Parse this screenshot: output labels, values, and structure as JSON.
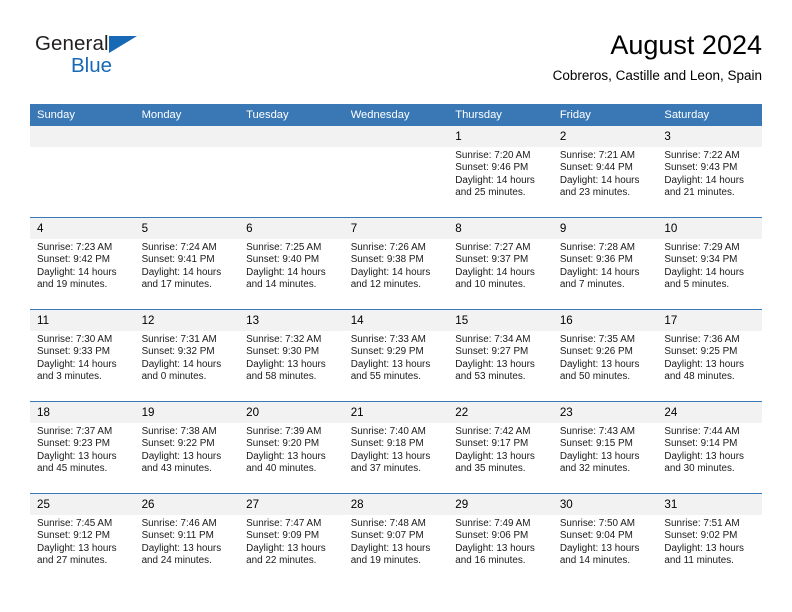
{
  "brand": {
    "name_dark": "General",
    "name_blue": "Blue",
    "accent_color": "#1769b5"
  },
  "header": {
    "title": "August 2024",
    "subtitle": "Cobreros, Castille and Leon, Spain"
  },
  "calendar": {
    "header_bg": "#3a78b5",
    "daynum_bg": "#f2f2f2",
    "weekday_headers": [
      "Sunday",
      "Monday",
      "Tuesday",
      "Wednesday",
      "Thursday",
      "Friday",
      "Saturday"
    ],
    "weeks": [
      [
        {
          "day": "",
          "lines": []
        },
        {
          "day": "",
          "lines": []
        },
        {
          "day": "",
          "lines": []
        },
        {
          "day": "",
          "lines": []
        },
        {
          "day": "1",
          "lines": [
            "Sunrise: 7:20 AM",
            "Sunset: 9:46 PM",
            "Daylight: 14 hours",
            "and 25 minutes."
          ]
        },
        {
          "day": "2",
          "lines": [
            "Sunrise: 7:21 AM",
            "Sunset: 9:44 PM",
            "Daylight: 14 hours",
            "and 23 minutes."
          ]
        },
        {
          "day": "3",
          "lines": [
            "Sunrise: 7:22 AM",
            "Sunset: 9:43 PM",
            "Daylight: 14 hours",
            "and 21 minutes."
          ]
        }
      ],
      [
        {
          "day": "4",
          "lines": [
            "Sunrise: 7:23 AM",
            "Sunset: 9:42 PM",
            "Daylight: 14 hours",
            "and 19 minutes."
          ]
        },
        {
          "day": "5",
          "lines": [
            "Sunrise: 7:24 AM",
            "Sunset: 9:41 PM",
            "Daylight: 14 hours",
            "and 17 minutes."
          ]
        },
        {
          "day": "6",
          "lines": [
            "Sunrise: 7:25 AM",
            "Sunset: 9:40 PM",
            "Daylight: 14 hours",
            "and 14 minutes."
          ]
        },
        {
          "day": "7",
          "lines": [
            "Sunrise: 7:26 AM",
            "Sunset: 9:38 PM",
            "Daylight: 14 hours",
            "and 12 minutes."
          ]
        },
        {
          "day": "8",
          "lines": [
            "Sunrise: 7:27 AM",
            "Sunset: 9:37 PM",
            "Daylight: 14 hours",
            "and 10 minutes."
          ]
        },
        {
          "day": "9",
          "lines": [
            "Sunrise: 7:28 AM",
            "Sunset: 9:36 PM",
            "Daylight: 14 hours",
            "and 7 minutes."
          ]
        },
        {
          "day": "10",
          "lines": [
            "Sunrise: 7:29 AM",
            "Sunset: 9:34 PM",
            "Daylight: 14 hours",
            "and 5 minutes."
          ]
        }
      ],
      [
        {
          "day": "11",
          "lines": [
            "Sunrise: 7:30 AM",
            "Sunset: 9:33 PM",
            "Daylight: 14 hours",
            "and 3 minutes."
          ]
        },
        {
          "day": "12",
          "lines": [
            "Sunrise: 7:31 AM",
            "Sunset: 9:32 PM",
            "Daylight: 14 hours",
            "and 0 minutes."
          ]
        },
        {
          "day": "13",
          "lines": [
            "Sunrise: 7:32 AM",
            "Sunset: 9:30 PM",
            "Daylight: 13 hours",
            "and 58 minutes."
          ]
        },
        {
          "day": "14",
          "lines": [
            "Sunrise: 7:33 AM",
            "Sunset: 9:29 PM",
            "Daylight: 13 hours",
            "and 55 minutes."
          ]
        },
        {
          "day": "15",
          "lines": [
            "Sunrise: 7:34 AM",
            "Sunset: 9:27 PM",
            "Daylight: 13 hours",
            "and 53 minutes."
          ]
        },
        {
          "day": "16",
          "lines": [
            "Sunrise: 7:35 AM",
            "Sunset: 9:26 PM",
            "Daylight: 13 hours",
            "and 50 minutes."
          ]
        },
        {
          "day": "17",
          "lines": [
            "Sunrise: 7:36 AM",
            "Sunset: 9:25 PM",
            "Daylight: 13 hours",
            "and 48 minutes."
          ]
        }
      ],
      [
        {
          "day": "18",
          "lines": [
            "Sunrise: 7:37 AM",
            "Sunset: 9:23 PM",
            "Daylight: 13 hours",
            "and 45 minutes."
          ]
        },
        {
          "day": "19",
          "lines": [
            "Sunrise: 7:38 AM",
            "Sunset: 9:22 PM",
            "Daylight: 13 hours",
            "and 43 minutes."
          ]
        },
        {
          "day": "20",
          "lines": [
            "Sunrise: 7:39 AM",
            "Sunset: 9:20 PM",
            "Daylight: 13 hours",
            "and 40 minutes."
          ]
        },
        {
          "day": "21",
          "lines": [
            "Sunrise: 7:40 AM",
            "Sunset: 9:18 PM",
            "Daylight: 13 hours",
            "and 37 minutes."
          ]
        },
        {
          "day": "22",
          "lines": [
            "Sunrise: 7:42 AM",
            "Sunset: 9:17 PM",
            "Daylight: 13 hours",
            "and 35 minutes."
          ]
        },
        {
          "day": "23",
          "lines": [
            "Sunrise: 7:43 AM",
            "Sunset: 9:15 PM",
            "Daylight: 13 hours",
            "and 32 minutes."
          ]
        },
        {
          "day": "24",
          "lines": [
            "Sunrise: 7:44 AM",
            "Sunset: 9:14 PM",
            "Daylight: 13 hours",
            "and 30 minutes."
          ]
        }
      ],
      [
        {
          "day": "25",
          "lines": [
            "Sunrise: 7:45 AM",
            "Sunset: 9:12 PM",
            "Daylight: 13 hours",
            "and 27 minutes."
          ]
        },
        {
          "day": "26",
          "lines": [
            "Sunrise: 7:46 AM",
            "Sunset: 9:11 PM",
            "Daylight: 13 hours",
            "and 24 minutes."
          ]
        },
        {
          "day": "27",
          "lines": [
            "Sunrise: 7:47 AM",
            "Sunset: 9:09 PM",
            "Daylight: 13 hours",
            "and 22 minutes."
          ]
        },
        {
          "day": "28",
          "lines": [
            "Sunrise: 7:48 AM",
            "Sunset: 9:07 PM",
            "Daylight: 13 hours",
            "and 19 minutes."
          ]
        },
        {
          "day": "29",
          "lines": [
            "Sunrise: 7:49 AM",
            "Sunset: 9:06 PM",
            "Daylight: 13 hours",
            "and 16 minutes."
          ]
        },
        {
          "day": "30",
          "lines": [
            "Sunrise: 7:50 AM",
            "Sunset: 9:04 PM",
            "Daylight: 13 hours",
            "and 14 minutes."
          ]
        },
        {
          "day": "31",
          "lines": [
            "Sunrise: 7:51 AM",
            "Sunset: 9:02 PM",
            "Daylight: 13 hours",
            "and 11 minutes."
          ]
        }
      ]
    ]
  }
}
